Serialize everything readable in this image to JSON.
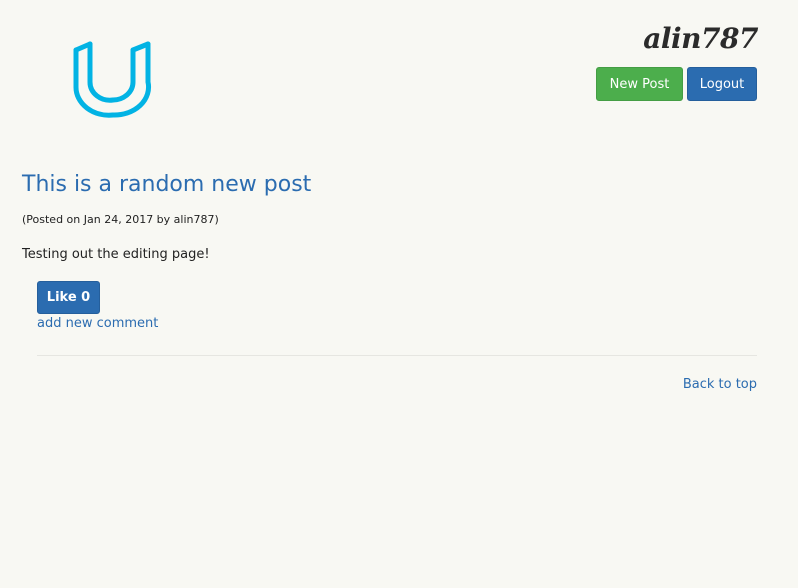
{
  "header": {
    "logo_icon": "udacity-u-logo-icon",
    "username": "alin787",
    "new_post_label": "New Post",
    "logout_label": "Logout"
  },
  "post": {
    "title": "This is a random new post",
    "meta": "(Posted on Jan 24, 2017 by alin787)",
    "body": "Testing out the editing page!",
    "like_label": "Like 0",
    "add_comment_label": "add new comment"
  },
  "footer": {
    "back_to_top_label": "Back to top"
  },
  "colors": {
    "background": "#f8f8f3",
    "primary": "#2b6cb0",
    "success": "#4cae4c",
    "logo": "#02b3e4"
  }
}
